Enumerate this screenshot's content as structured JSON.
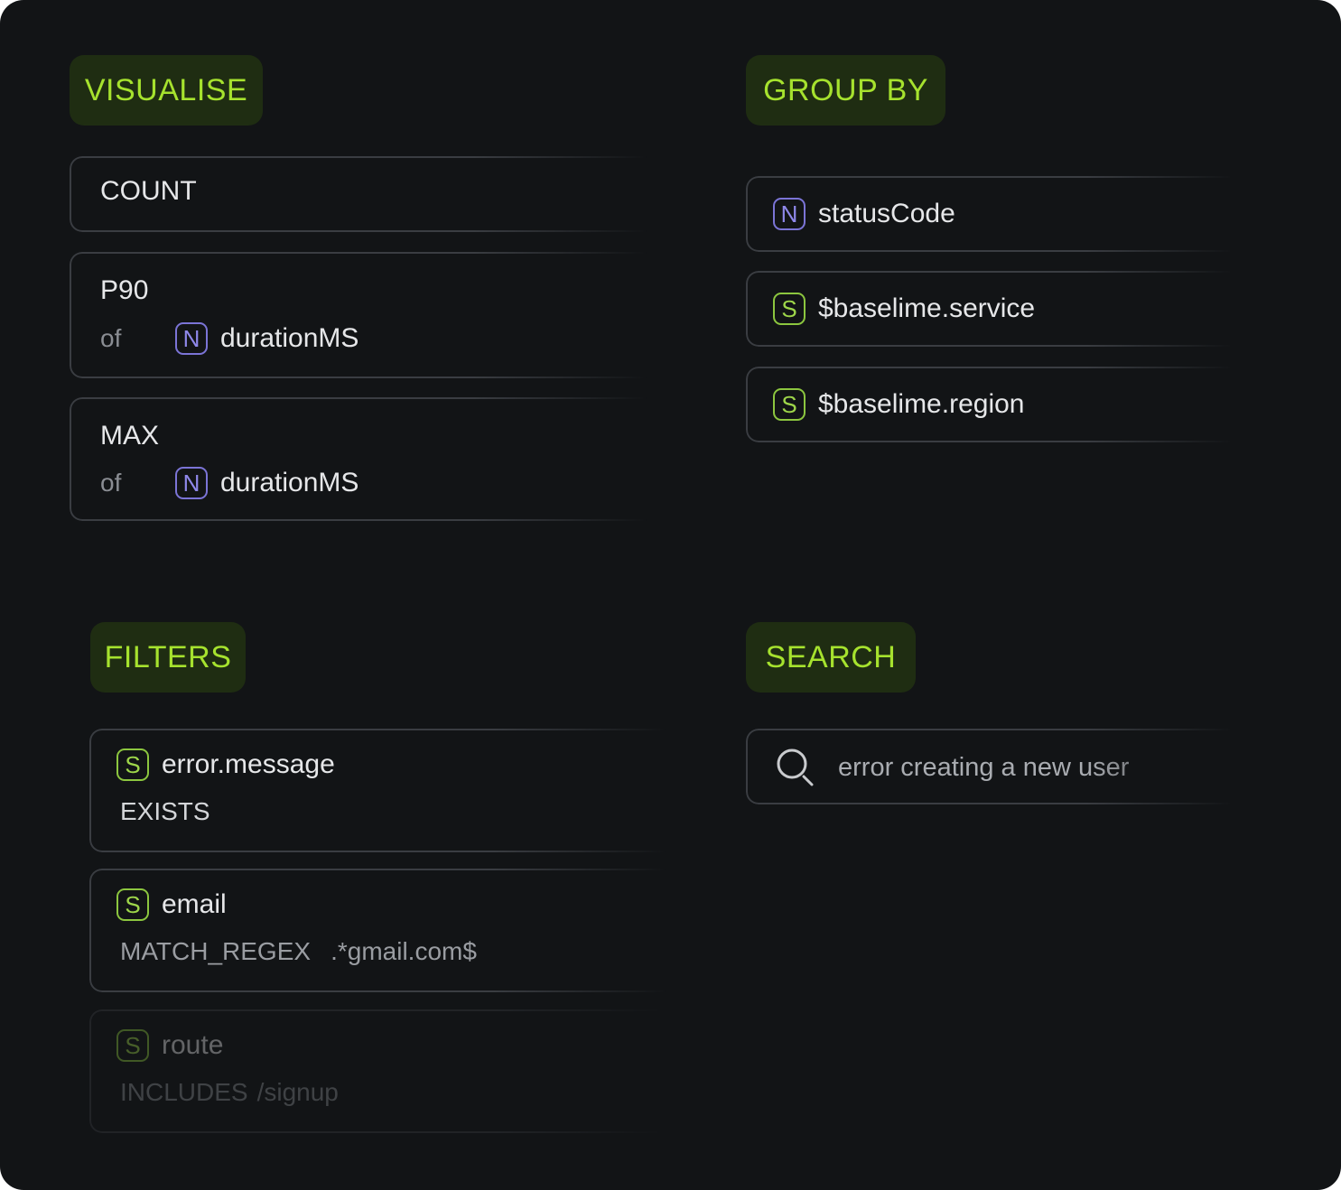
{
  "visualise": {
    "tag": "VISUALISE",
    "items": [
      {
        "op": "COUNT"
      },
      {
        "op": "P90",
        "of_label": "of",
        "field_type": "N",
        "field": "durationMS"
      },
      {
        "op": "MAX",
        "of_label": "of",
        "field_type": "N",
        "field": "durationMS"
      }
    ]
  },
  "group_by": {
    "tag": "GROUP BY",
    "items": [
      {
        "type": "N",
        "field": "statusCode"
      },
      {
        "type": "S",
        "field": "$baselime.service"
      },
      {
        "type": "S",
        "field": "$baselime.region"
      }
    ]
  },
  "filters": {
    "tag": "FILTERS",
    "items": [
      {
        "type": "S",
        "field": "error.message",
        "operator": "EXISTS",
        "value": ""
      },
      {
        "type": "S",
        "field": "email",
        "operator": "MATCH_REGEX",
        "value": ".*gmail.com$"
      },
      {
        "type": "S",
        "field": "route",
        "operator": "INCLUDES",
        "value": "/signup"
      }
    ]
  },
  "search": {
    "tag": "SEARCH",
    "icon": "search-icon",
    "query": "error creating a new user"
  },
  "colors": {
    "background": "#121416",
    "tag_bg": "#1f2d12",
    "tag_text": "#a6e22e",
    "number_type": "#7b74d6",
    "string_type": "#8cc63f"
  }
}
